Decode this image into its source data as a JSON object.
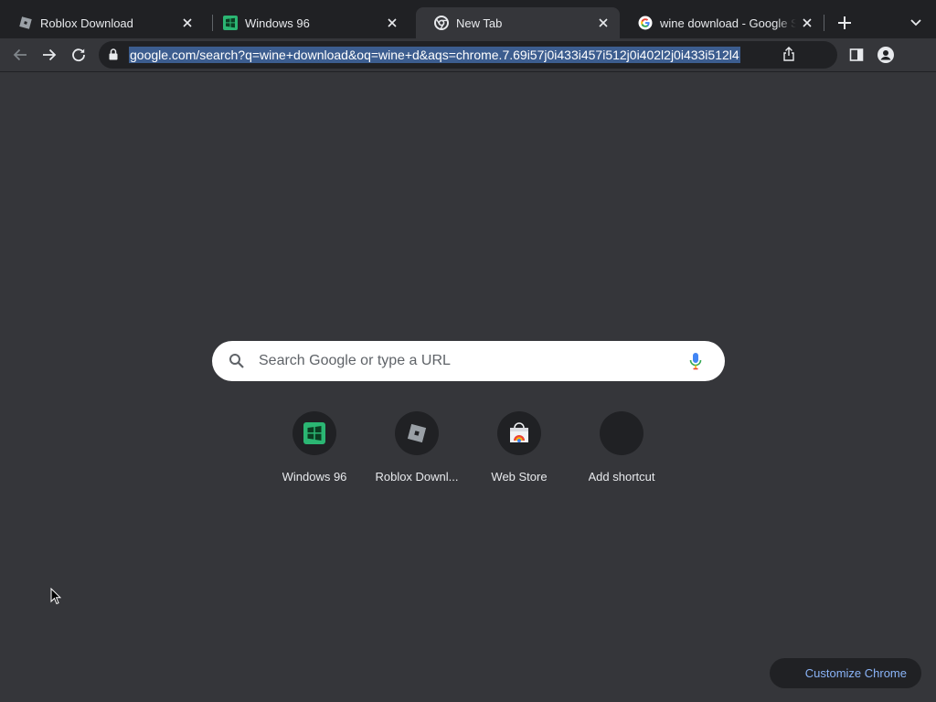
{
  "tabs": [
    {
      "title": "Roblox Download",
      "favicon": "roblox-icon",
      "active": false
    },
    {
      "title": "Windows 96",
      "favicon": "windows96-icon",
      "active": false
    },
    {
      "title": "New Tab",
      "favicon": "chrome-icon",
      "active": true
    },
    {
      "title": "wine download - Google Search",
      "favicon": "google-icon",
      "active": false
    }
  ],
  "omnibox": {
    "url": "google.com/search?q=wine+download&oq=wine+d&aqs=chrome.7.69i57j0i433i457i512j0i402l2j0i433i512l4",
    "selected": true
  },
  "ntp": {
    "search_placeholder": "Search Google or type a URL",
    "shortcuts": [
      {
        "label": "Windows 96",
        "icon": "windows96-icon"
      },
      {
        "label": "Roblox Downl...",
        "icon": "roblox-icon"
      },
      {
        "label": "Web Store",
        "icon": "webstore-icon"
      },
      {
        "label": "Add shortcut",
        "icon": "add-icon"
      }
    ],
    "customize_label": "Customize Chrome"
  },
  "colors": {
    "background": "#35363a",
    "tabstrip": "#202124",
    "accent_link": "#8ab4f8",
    "selection": "#3c5d8f"
  }
}
